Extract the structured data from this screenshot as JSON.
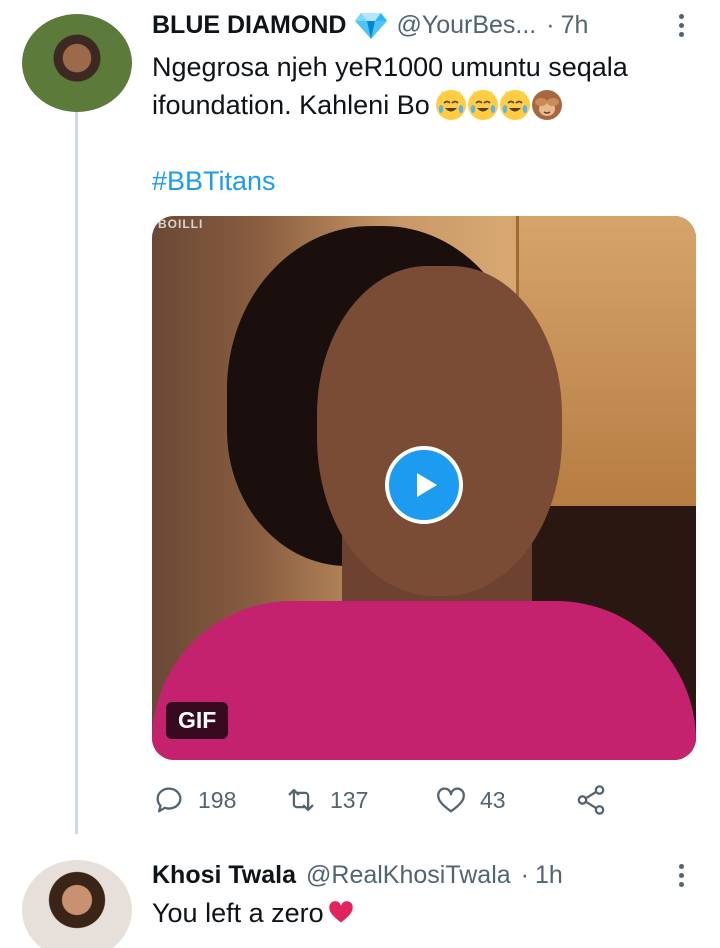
{
  "tweet": {
    "name": "BLUE DIAMOND",
    "handle": "@YourBes...",
    "dot": "·",
    "time": "7h",
    "text": "Ngegrosa njeh yeR1000 umuntu seqala ifoundation. Kahleni Bo",
    "emojis": [
      "laughing-tears-cat",
      "laughing-tears-cat",
      "laughing-tears-cat",
      "see-no-evil-monkey"
    ],
    "hashtag": "#BBTitans",
    "media": {
      "watermark": "BOILLI",
      "badge": "GIF"
    },
    "stats": {
      "replies": "198",
      "retweets": "137",
      "likes": "43"
    }
  },
  "reply": {
    "name": "Khosi Twala",
    "handle": "@RealKhosiTwala",
    "dot": "·",
    "time": "1h",
    "text": "You left a zero"
  },
  "colors": {
    "link": "#1d9bf0",
    "muted": "#536471",
    "text": "#0f1419",
    "thread_line": "#cfd9de"
  },
  "icons": [
    "verified-diamond-icon",
    "more-icon",
    "play-icon",
    "reply-icon",
    "retweet-icon",
    "like-icon",
    "share-icon",
    "heart-emoji-icon"
  ]
}
